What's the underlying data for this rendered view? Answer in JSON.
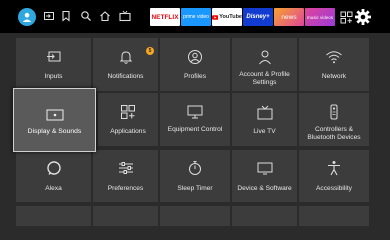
{
  "apps": {
    "netflix": "NETFLIX",
    "prime": "prime video",
    "youtube": "YouTube",
    "disney": "Disney+",
    "news": "news",
    "music": "music videos"
  },
  "tiles": {
    "inputs": "Inputs",
    "notifications": "Notifications",
    "notifications_badge": "5",
    "profiles": "Profiles",
    "account": "Account & Profile Settings",
    "network": "Network",
    "display": "Display & Sounds",
    "applications": "Applications",
    "equipment": "Equipment Control",
    "livetv": "Live TV",
    "controllers": "Controllers & Bluetooth Devices",
    "alexa": "Alexa",
    "preferences": "Preferences",
    "sleep": "Sleep Timer",
    "device": "Device & Software",
    "accessibility": "Accessibility"
  },
  "colors": {
    "background": "#2b2b2b",
    "tile": "#3c3c3c",
    "focused_tile": "#5a5a5a",
    "avatar": "#2fa8e0",
    "badge": "#f5a623"
  }
}
